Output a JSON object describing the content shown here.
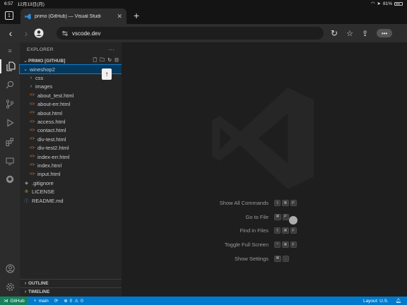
{
  "ios": {
    "time": "6:57",
    "date": "12月13日(月)",
    "battery": "81%",
    "battery_level": 0.81
  },
  "browser": {
    "tab_count": "1",
    "tab_title": "primo (GitHub) — Visual Studi",
    "url": "vscode.dev"
  },
  "explorer": {
    "title": "EXPLORER",
    "repo": "PRIMO [GITHUB]",
    "items": [
      {
        "label": "wineshop2",
        "kind": "folder-open",
        "indent": 1,
        "selected": true
      },
      {
        "label": "css",
        "kind": "folder",
        "indent": 2
      },
      {
        "label": "images",
        "kind": "folder",
        "indent": 2
      },
      {
        "label": "about_test.html",
        "kind": "html",
        "indent": 2
      },
      {
        "label": "about-err.html",
        "kind": "html",
        "indent": 2
      },
      {
        "label": "about.html",
        "kind": "html",
        "indent": 2
      },
      {
        "label": "access.html",
        "kind": "html",
        "indent": 2
      },
      {
        "label": "contact.html",
        "kind": "html",
        "indent": 2
      },
      {
        "label": "div-test.html",
        "kind": "html",
        "indent": 2
      },
      {
        "label": "div-test2.html",
        "kind": "html",
        "indent": 2
      },
      {
        "label": "index-err.html",
        "kind": "html",
        "indent": 2
      },
      {
        "label": "index.html",
        "kind": "html",
        "indent": 2
      },
      {
        "label": "input.html",
        "kind": "html",
        "indent": 2
      },
      {
        "label": ".gitignore",
        "kind": "git",
        "indent": 1
      },
      {
        "label": "LICENSE",
        "kind": "license",
        "indent": 1
      },
      {
        "label": "README.md",
        "kind": "info",
        "indent": 1
      }
    ],
    "outline": "OUTLINE",
    "timeline": "TIMELINE"
  },
  "welcome": {
    "shortcuts": [
      {
        "label": "Show All Commands",
        "keys": [
          "⇧",
          "⌘",
          "P"
        ]
      },
      {
        "label": "Go to File",
        "keys": [
          "⌘",
          "P"
        ]
      },
      {
        "label": "Find in Files",
        "keys": [
          "⇧",
          "⌘",
          "F"
        ]
      },
      {
        "label": "Toggle Full Screen",
        "keys": [
          "^",
          "⌘",
          "F"
        ]
      },
      {
        "label": "Show Settings",
        "keys": [
          "⌘",
          ","
        ]
      }
    ]
  },
  "statusbar": {
    "remote": "GitHub",
    "branch": "main",
    "errors": "0",
    "warnings": "0",
    "layout": "Layout: U.S."
  },
  "colors": {
    "statusbar": "#007acc",
    "remote": "#16825d",
    "selection": "#04395e",
    "html_icon": "#e37933"
  }
}
